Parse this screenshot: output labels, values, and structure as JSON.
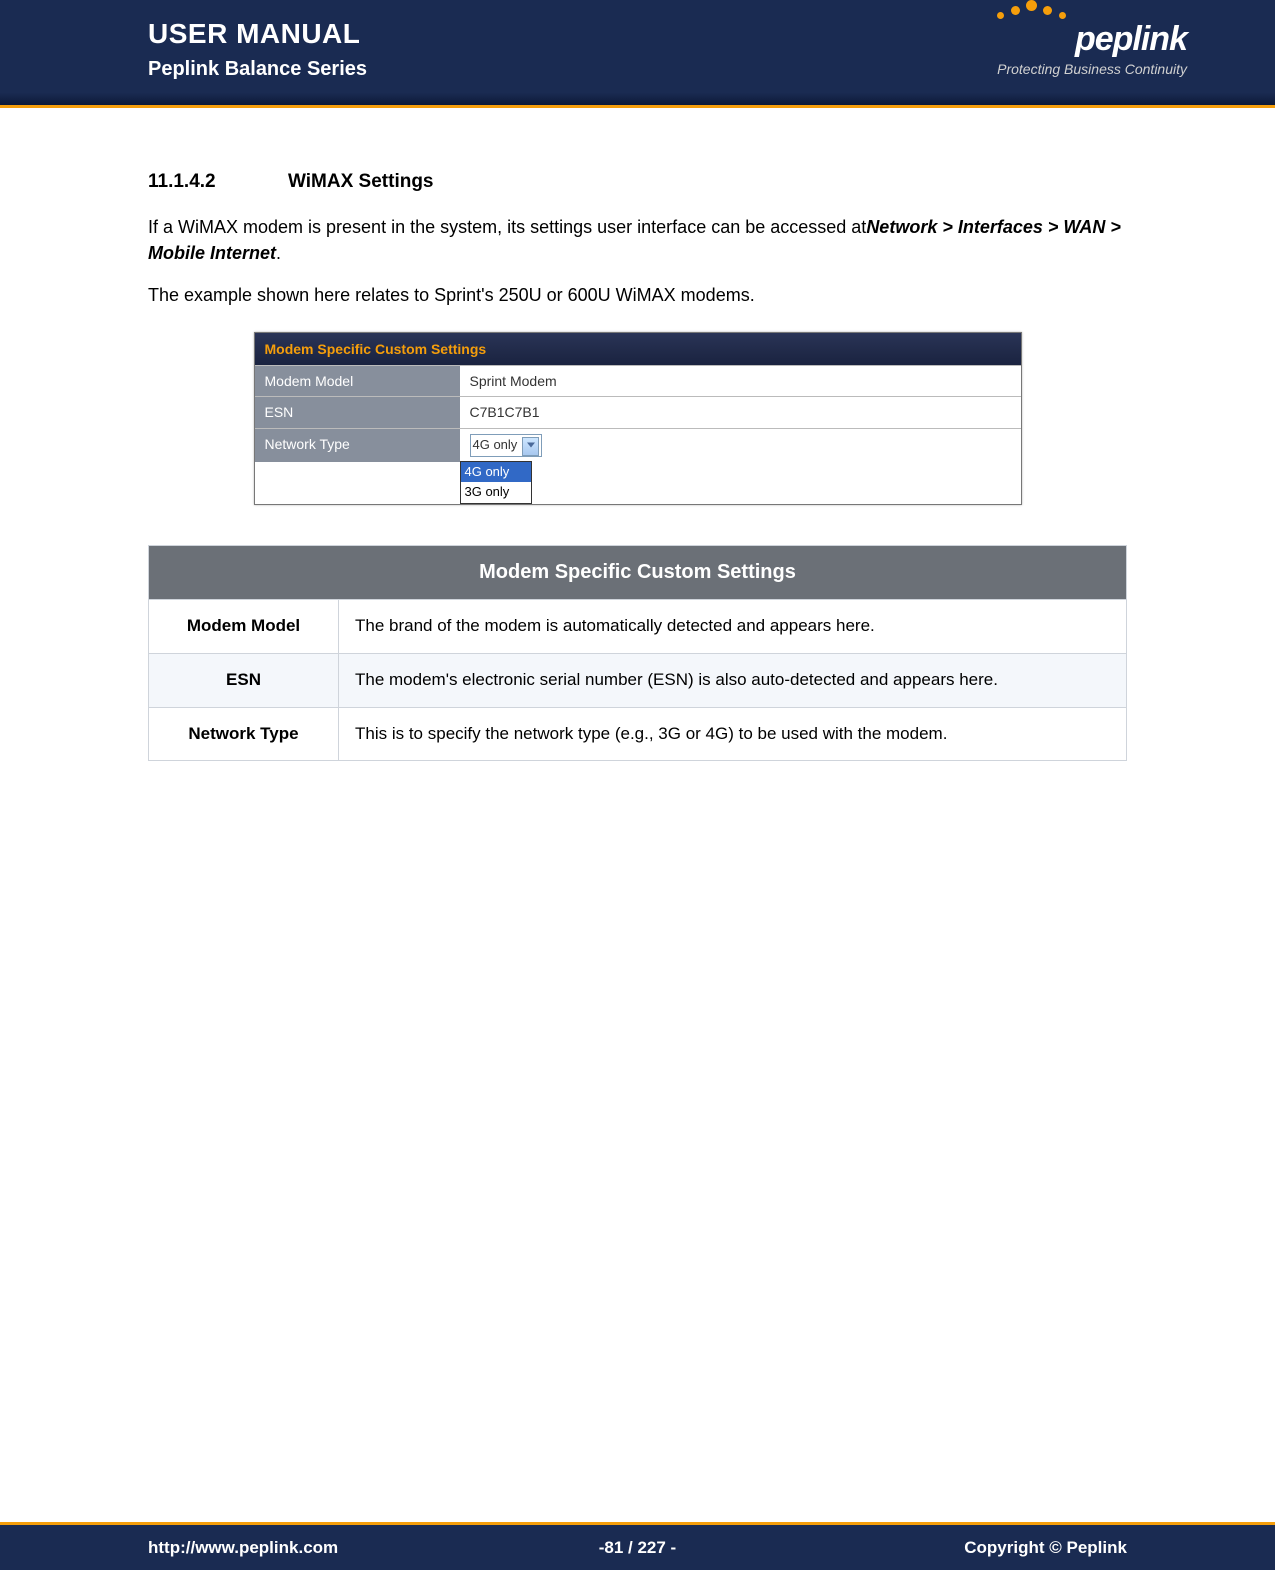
{
  "header": {
    "title": "USER MANUAL",
    "subtitle": "Peplink Balance Series",
    "logo_text": "peplink",
    "logo_tagline": "Protecting Business Continuity"
  },
  "section": {
    "number": "11.1.4.2",
    "title": "WiMAX Settings"
  },
  "paragraphs": {
    "p1_part1": "If a WiMAX modem is present in the system, its settings user interface can be accessed at",
    "p1_breadcrumb": "Network > Interfaces > WAN > Mobile Internet",
    "p1_part2": ".",
    "p2": "The example shown here relates to Sprint's 250U or 600U WiMAX modems."
  },
  "screenshot": {
    "title": "Modem Specific Custom Settings",
    "rows": [
      {
        "label": "Modem Model",
        "value": "Sprint Modem"
      },
      {
        "label": "ESN",
        "value": "C7B1C7B1"
      },
      {
        "label": "Network Type",
        "value": "4G only"
      }
    ],
    "dropdown_options": [
      "4G only",
      "3G only"
    ]
  },
  "desc_table": {
    "header": "Modem Specific Custom Settings",
    "rows": [
      {
        "label": "Modem Model",
        "desc": "The brand of the modem is automatically detected and appears here."
      },
      {
        "label": "ESN",
        "desc": "The modem's electronic serial number (ESN) is also auto-detected and appears here."
      },
      {
        "label": "Network Type",
        "desc": "This is to specify the network type (e.g., 3G or 4G) to be used with the modem."
      }
    ]
  },
  "footer": {
    "url": "http://www.peplink.com",
    "page": "-81 / 227 -",
    "copyright": "Copyright ©  Peplink"
  }
}
